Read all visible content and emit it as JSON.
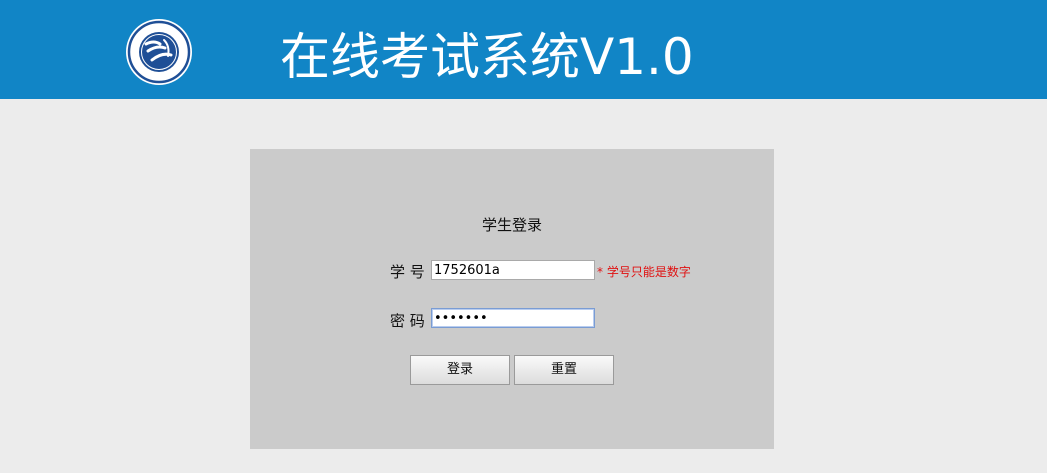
{
  "header": {
    "title": "在线考试系统V1.0",
    "background_color": "#1185c6",
    "logo_icon": "university-seal-icon"
  },
  "login": {
    "title": "学生登录",
    "student_id_label": "学 号",
    "student_id_value": "1752601a",
    "student_id_hint": "* 学号只能是数字",
    "password_label": "密 码",
    "password_value": "•••••••",
    "login_button": "登录",
    "reset_button": "重置",
    "hint_color": "#e01010"
  }
}
